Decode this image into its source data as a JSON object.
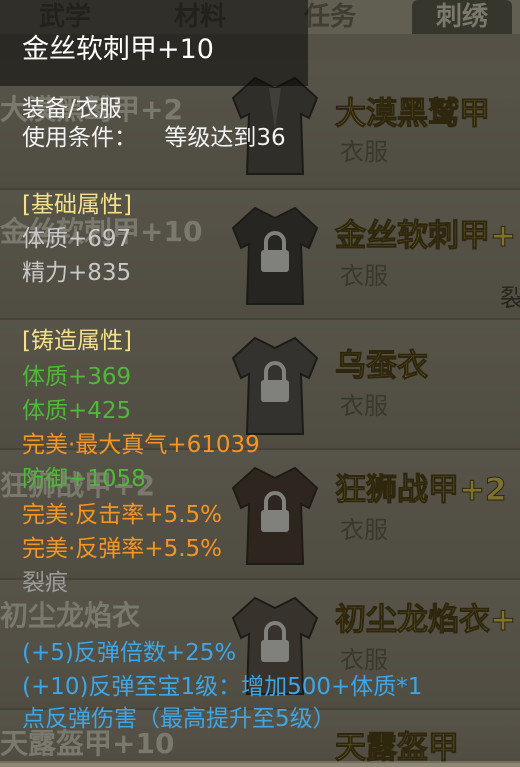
{
  "background": {
    "tabs": [
      "武学",
      "材料",
      "任务",
      "刺绣"
    ],
    "items": [
      {
        "name": "大漠黑鹫甲",
        "type": "衣服",
        "left_text": "大漠黑鹫甲+2"
      },
      {
        "name": "金丝软刺甲+",
        "type": "衣服",
        "left_text": "金丝软刺甲+10"
      },
      {
        "name": "乌蚕衣",
        "type": "衣服",
        "left_text": ""
      },
      {
        "name": "狂狮战甲+2",
        "type": "衣服",
        "left_text": "狂狮战甲+2"
      },
      {
        "name": "初尘龙焰衣+",
        "type": "衣服",
        "left_text": "初尘龙焰衣"
      },
      {
        "name": "天露盔甲",
        "type": "",
        "left_text": "天露盔甲+10"
      }
    ],
    "side_text": "裂"
  },
  "tooltip": {
    "title": "金丝软刺甲+10",
    "category": "装备/衣服",
    "requirement_label": "使用条件：",
    "requirement_value": "等级达到36",
    "base_header": "[基础属性]",
    "base_attrs": [
      "体质+697",
      "精力+835"
    ],
    "forge_header": "[铸造属性]",
    "forge_attrs": [
      {
        "text": "体质+369",
        "color": "#4fb83b"
      },
      {
        "text": "体质+425",
        "color": "#4fb83b"
      },
      {
        "text": "完美·最大真气+61039",
        "color": "#f59521"
      },
      {
        "text": "防御+1058",
        "color": "#4fb83b"
      },
      {
        "text": "完美·反击率+5.5%",
        "color": "#f59521"
      },
      {
        "text": "完美·反弹率+5.5%",
        "color": "#f59521"
      },
      {
        "text": "裂痕",
        "color": "#9a9a98"
      }
    ],
    "set_effects": [
      "(+5)反弹倍数+25%",
      "(+10)反弹至宝1级：增加500+体质*1",
      "点反弹伤害（最高提升至5级）"
    ]
  }
}
